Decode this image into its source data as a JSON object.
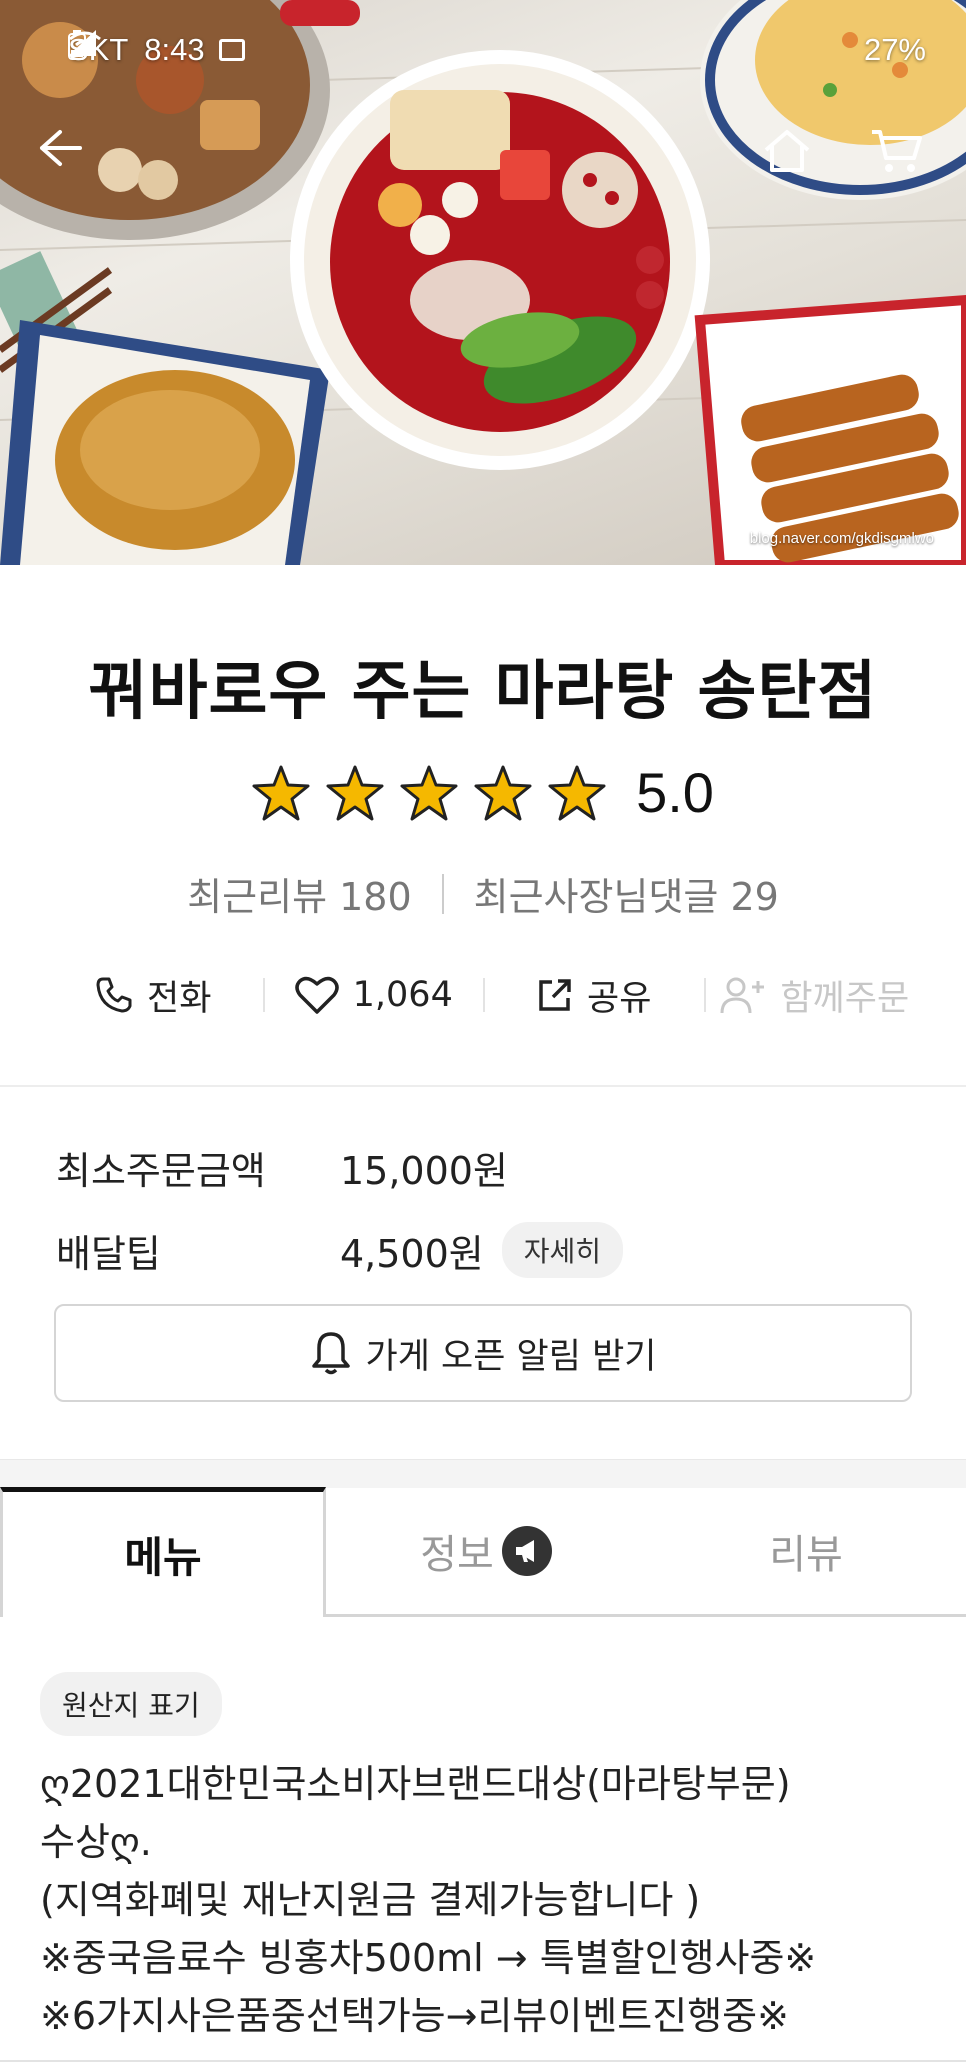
{
  "status_bar": {
    "carrier": "SKT",
    "time": "8:43",
    "battery": "27%"
  },
  "hero": {
    "watermark": "blog.naver.com/gkdisgmlwo",
    "icons": [
      "back-arrow-icon",
      "home-icon",
      "cart-icon"
    ]
  },
  "store": {
    "name": "꿔바로우 주는 마라탕 송탄점",
    "rating": "5.0",
    "stars": 5,
    "recent_reviews": "최근리뷰 180",
    "owner_replies": "최근사장님댓글 29"
  },
  "actions": {
    "call": "전화",
    "likes": "1,064",
    "share": "공유",
    "group_order": "함께주문"
  },
  "order_info": {
    "min_order_label": "최소주문금액",
    "min_order_value": "15,000원",
    "delivery_tip_label": "배달팁",
    "delivery_tip_value": "4,500원",
    "detail_label": "자세히",
    "notify_label": "가게 오픈 알림 받기"
  },
  "tabs": {
    "menu": "메뉴",
    "info": "정보",
    "review": "리뷰"
  },
  "menu": {
    "origin_label": "원산지 표기",
    "notice_lines": [
      "ღ2021대한민국소비자브랜드대상(마라탕부문)",
      "수상ღ.",
      "(지역화폐및 재난지원금 결제가능합니다 )",
      "※중국음료수 빙홍차500ml → 특별할인행사중※",
      "※6가지사은품중선택가능→리뷰이벤트진행중※"
    ]
  },
  "colors": {
    "star": "#f5b800",
    "broth": "#b3141c",
    "active_tab_border": "#111111"
  }
}
